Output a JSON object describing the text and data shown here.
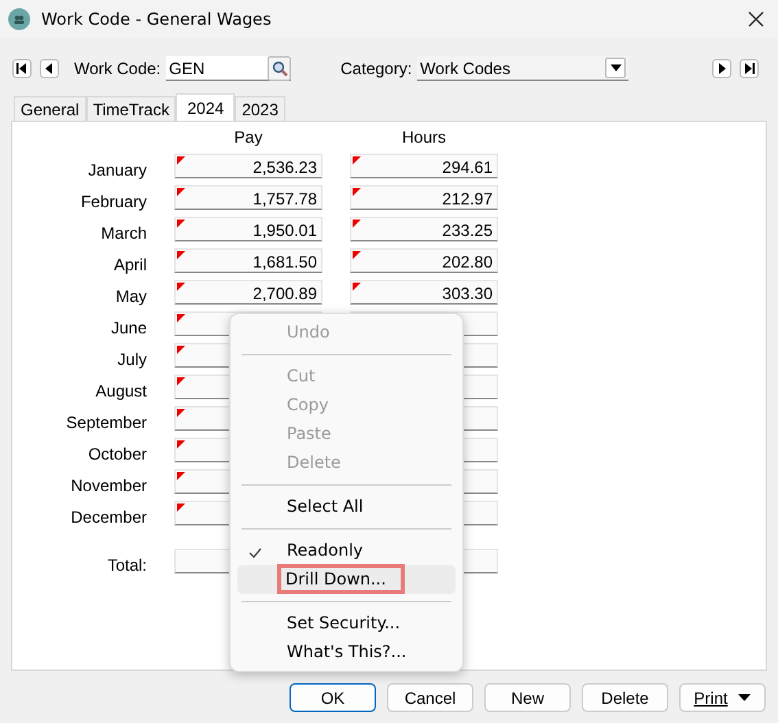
{
  "window": {
    "title": "Work Code - General Wages"
  },
  "toolbar": {
    "work_code_label": "Work Code:",
    "work_code": "GEN",
    "category_label": "Category:",
    "category": "Work Codes"
  },
  "tabs": [
    {
      "label": "General",
      "selected": false
    },
    {
      "label": "TimeTrack",
      "selected": false
    },
    {
      "label": "2024",
      "selected": true
    },
    {
      "label": "2023",
      "selected": false
    }
  ],
  "columns": [
    "Pay",
    "Hours"
  ],
  "rows": [
    {
      "month": "January",
      "pay": "2,536.23",
      "hours": "294.61"
    },
    {
      "month": "February",
      "pay": "1,757.78",
      "hours": "212.97"
    },
    {
      "month": "March",
      "pay": "1,950.01",
      "hours": "233.25"
    },
    {
      "month": "April",
      "pay": "1,681.50",
      "hours": "202.80"
    },
    {
      "month": "May",
      "pay": "2,700.89",
      "hours": "303.30"
    },
    {
      "month": "June"
    },
    {
      "month": "July"
    },
    {
      "month": "August"
    },
    {
      "month": "September"
    },
    {
      "month": "October"
    },
    {
      "month": "November"
    },
    {
      "month": "December"
    }
  ],
  "total_label": "Total:",
  "context_menu": [
    {
      "kind": "item",
      "label": "Undo",
      "disabled": true,
      "checked": false,
      "selected": false
    },
    {
      "kind": "separator"
    },
    {
      "kind": "item",
      "label": "Cut",
      "disabled": true,
      "checked": false,
      "selected": false
    },
    {
      "kind": "item",
      "label": "Copy",
      "disabled": true,
      "checked": false,
      "selected": false
    },
    {
      "kind": "item",
      "label": "Paste",
      "disabled": true,
      "checked": false,
      "selected": false
    },
    {
      "kind": "item",
      "label": "Delete",
      "disabled": true,
      "checked": false,
      "selected": false
    },
    {
      "kind": "separator"
    },
    {
      "kind": "item",
      "label": "Select All",
      "disabled": false,
      "checked": false,
      "selected": false
    },
    {
      "kind": "separator"
    },
    {
      "kind": "item",
      "label": "Readonly",
      "disabled": false,
      "checked": true,
      "selected": false
    },
    {
      "kind": "item",
      "label": "Drill Down...",
      "disabled": false,
      "checked": false,
      "selected": true
    },
    {
      "kind": "separator"
    },
    {
      "kind": "item",
      "label": "Set Security...",
      "disabled": false,
      "checked": false,
      "selected": false
    },
    {
      "kind": "item",
      "label": "What's This?...",
      "disabled": false,
      "checked": false,
      "selected": false
    }
  ],
  "buttons": [
    {
      "label": "OK",
      "kind": "default"
    },
    {
      "label": "Cancel",
      "kind": "normal"
    },
    {
      "label": "New",
      "kind": "normal"
    },
    {
      "label": "Delete",
      "kind": "normal"
    },
    {
      "label": "Print",
      "kind": "dropdown"
    }
  ]
}
